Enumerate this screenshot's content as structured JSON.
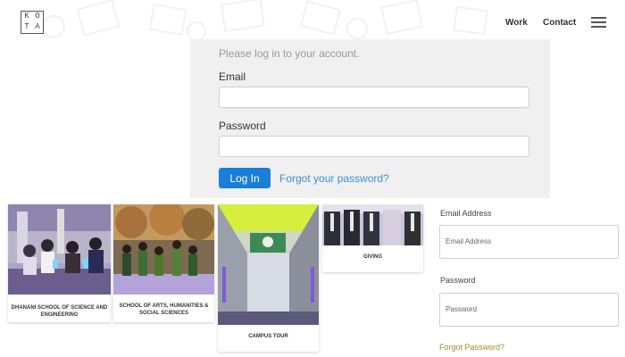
{
  "header": {
    "logo_letters": [
      "K",
      "O",
      "T",
      "A"
    ],
    "nav": {
      "work": "Work",
      "contact": "Contact"
    }
  },
  "login": {
    "subtitle": "Please log in to your account.",
    "email_label": "Email",
    "password_label": "Password",
    "login_button": "Log In",
    "forgot_link": "Forgot your password?"
  },
  "cards": [
    {
      "caption_line1": "DHANANI SCHOOL OF SCIENCE AND",
      "caption_line2": "ENGINEERING"
    },
    {
      "caption_line1": "SCHOOL OF ARTS, HUMANITIES &",
      "caption_line2": "SOCIAL SCIENCES"
    },
    {
      "caption_line1": "CAMPUS TOUR",
      "caption_line2": ""
    },
    {
      "caption_line1": "GIVING",
      "caption_line2": ""
    }
  ],
  "side_form": {
    "email_label": "Email Address",
    "email_placeholder": "Email Address",
    "password_label": "Password",
    "password_placeholder": "Password",
    "forgot_link": "Forgot Password?"
  },
  "colors": {
    "login_button": "#1a7fd8",
    "link": "#3a8fdb",
    "accent_purple": "#7b5cd6"
  }
}
